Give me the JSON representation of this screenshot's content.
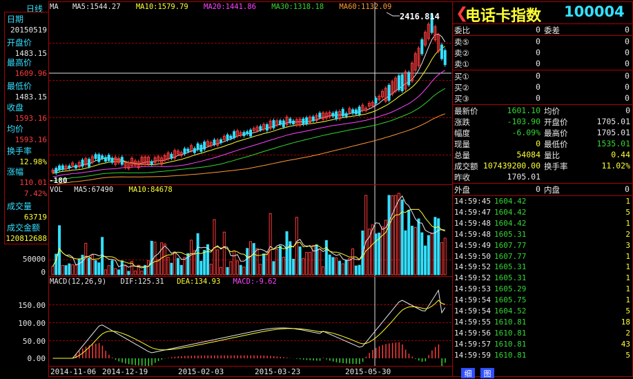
{
  "left_panel": {
    "tab": "日线",
    "items": [
      {
        "label": "日期",
        "value": "20150519",
        "color": "#e8e8e8"
      },
      {
        "label": "开盘价",
        "value": "1483.15",
        "color": "#e8e8e8"
      },
      {
        "label": "最高价",
        "value": "1609.96",
        "color": "#ff3b3b"
      },
      {
        "label": "最低价",
        "value": "1483.15",
        "color": "#e8e8e8"
      },
      {
        "label": "收盘",
        "value": "1593.16",
        "color": "#ff3b3b"
      },
      {
        "label": "均价",
        "value": "1593.16",
        "color": "#ff3b3b"
      },
      {
        "label": "换手率",
        "value": "12.98%",
        "color": "#ffff33"
      },
      {
        "label": "涨幅",
        "value": "110.01",
        "color": "#ff3b3b",
        "value2": "7.42%"
      },
      {
        "label": "成交量",
        "value": "63719",
        "color": "#ffff33"
      },
      {
        "label": "成交金额",
        "value": "120812688",
        "color": "#ffff33"
      }
    ]
  },
  "ma_header": {
    "ma": "MA",
    "ma5": "MA5:1544.27",
    "ma10": "MA10:1579.79",
    "ma20": "MA20:1441.86",
    "ma30": "MA30:1318.18",
    "ma60": "MA60:1132.09"
  },
  "price_chart": {
    "high_label": "2416.814",
    "low_label": "-180"
  },
  "vol_header": {
    "vol": "VOL",
    "ma5": "MA5:67490",
    "ma10": "MA10:84678"
  },
  "vol_axis": [
    "50000",
    "0"
  ],
  "macd_header": {
    "macd": "MACD(12,26,9)",
    "dif": "DIF:125.31",
    "dea": "DEA:134.93",
    "macd_val": "MACD:-9.62"
  },
  "macd_axis": [
    "150.00",
    "100.00",
    "50.00",
    "0.00"
  ],
  "dates": [
    "2014-11-06",
    "2014-12-19",
    "2015-02-03",
    "2015-03-23",
    "2015-05-30"
  ],
  "quote": {
    "title": "电话卡指数",
    "code": "100004",
    "weibi_label": "委比",
    "weibi": "0",
    "weicha_label": "委差",
    "weicha": "0",
    "sells": [
      {
        "label": "卖⑤",
        "price": "0",
        "vol": "0"
      },
      {
        "label": "卖②",
        "price": "0",
        "vol": "0"
      },
      {
        "label": "卖①",
        "price": "0",
        "vol": "0"
      }
    ],
    "buys": [
      {
        "label": "买①",
        "price": "0",
        "vol": "0"
      },
      {
        "label": "买②",
        "price": "0",
        "vol": "0"
      },
      {
        "label": "买③",
        "price": "0",
        "vol": "0"
      }
    ],
    "stats": [
      {
        "l1": "最新价",
        "v1": "1601.10",
        "c1": "#33d633",
        "l2": "均价",
        "v2": "0",
        "c2": "#e8e8e8"
      },
      {
        "l1": "涨跌",
        "v1": "-103.90",
        "c1": "#33d633",
        "l2": "开盘价",
        "v2": "1705.01",
        "c2": "#e8e8e8"
      },
      {
        "l1": "幅度",
        "v1": "-6.09%",
        "c1": "#33d633",
        "l2": "最高价",
        "v2": "1705.01",
        "c2": "#e8e8e8"
      },
      {
        "l1": "现量",
        "v1": "0",
        "c1": "#ffff33",
        "l2": "最低价",
        "v2": "1535.01",
        "c2": "#33d633"
      },
      {
        "l1": "总量",
        "v1": "54084",
        "c1": "#ffff33",
        "l2": "量比",
        "v2": "0.44",
        "c2": "#ffff33"
      },
      {
        "l1": "成交额",
        "v1": "107439200.00",
        "c1": "#ffff33",
        "l2": "换手率",
        "v2": "11.02%",
        "c2": "#ffff33"
      },
      {
        "l1": "昨收",
        "v1": "1705.01",
        "c1": "#e8e8e8",
        "l2": "",
        "v2": "",
        "c2": "#e8e8e8"
      }
    ],
    "waipan_label": "外盘",
    "waipan": "0",
    "neipan_label": "内盘",
    "neipan": "0"
  },
  "ticks": [
    {
      "time": "14:59:45",
      "price": "1604.42",
      "vol": "1"
    },
    {
      "time": "14:59:47",
      "price": "1604.42",
      "vol": "5"
    },
    {
      "time": "14:59:48",
      "price": "1604.42",
      "vol": "1"
    },
    {
      "time": "14:59:48",
      "price": "1605.31",
      "vol": "2"
    },
    {
      "time": "14:59:49",
      "price": "1607.77",
      "vol": "3"
    },
    {
      "time": "14:59:50",
      "price": "1607.77",
      "vol": "1"
    },
    {
      "time": "14:59:52",
      "price": "1605.31",
      "vol": "1"
    },
    {
      "time": "14:59:52",
      "price": "1605.31",
      "vol": "1"
    },
    {
      "time": "14:59:53",
      "price": "1605.29",
      "vol": "1"
    },
    {
      "time": "14:59:54",
      "price": "1605.75",
      "vol": "1"
    },
    {
      "time": "14:59:54",
      "price": "1604.52",
      "vol": "5"
    },
    {
      "time": "14:59:55",
      "price": "1610.81",
      "vol": "18"
    },
    {
      "time": "14:59:56",
      "price": "1610.81",
      "vol": "2"
    },
    {
      "time": "14:59:57",
      "price": "1610.81",
      "vol": "43"
    },
    {
      "time": "14:59:59",
      "price": "1610.81",
      "vol": "5"
    }
  ],
  "bottom_tabs": [
    "细",
    "图"
  ]
}
